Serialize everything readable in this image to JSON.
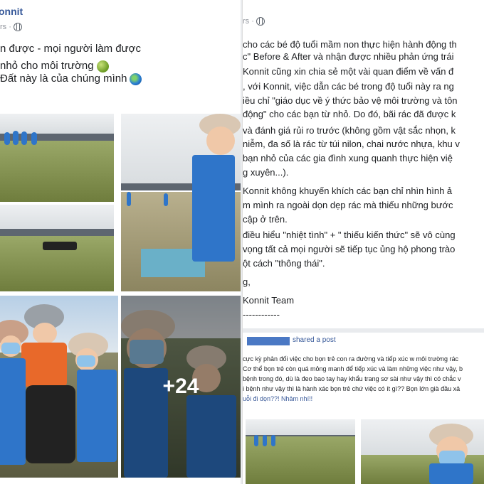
{
  "left_post": {
    "page_name": "onnit",
    "time": "rs ·",
    "lines": [
      "n được - mọi người làm được",
      "nhỏ cho môi trường",
      "Đất này là của chúng mình"
    ],
    "more_photos": "+24"
  },
  "right_post": {
    "time": "rs ·",
    "paragraphs": [
      "cho các bé độ tuổi mầm non thực hiện hành động th",
      "c\" Before & After và nhận được nhiều phản ứng trái",
      "Konnit cũng xin chia sẻ một vài quan điểm về vấn đ",
      ", với Konnit, việc dẫn các bé trong độ tuổi này ra ng",
      "iều chỉ \"giáo dục về ý thức bảo vệ môi trường và tôn",
      "động\" cho các bạn từ nhỏ. Do đó, bãi rác đã được k",
      "và đánh giá rủi ro trước (không gồm vật sắc nhọn, k",
      "niễm, đa số là rác từ túi nilon, chai nước nhựa, khu v",
      "bạn nhỏ của các gia đình xung quanh thực hiện việ",
      "g xuyên...).",
      "Konnit không khuyến khích các bạn chỉ nhìn hình ả",
      "m mình ra ngoài dọn dẹp rác mà thiếu những bước",
      "cập ở trên.",
      "điều hiểu \"nhiệt tình\" + \" thiếu kiến thức\" sẽ vô cùng",
      "vọng tất cả mọi người sẽ tiếp tục ủng hộ phong trào",
      "ột cách \"thông thái\".",
      "g,",
      "Konnit Team",
      "------------"
    ],
    "shared_post": {
      "label": "shared a post",
      "lines": [
        "cực kỳ phản đối việc cho bọn trẻ con ra đường và tiếp xúc w môi trường rác",
        "Cơ thể bọn trẻ còn quá mỏng manh để tiếp xúc và làm những việc như vậy, b",
        "bệnh trong đó, dù là đeo bao tay hay khẩu trang sơ sài như vậy thì có chắc v",
        "i bệnh như vậy thì là hành xác bọn trẻ chứ việc có ít gì?? Bọn lớn già đầu xả",
        "uỗi đi dọn??! Nhảm nhí!!"
      ]
    }
  },
  "colors": {
    "link_blue": "#365899",
    "shirt_blue": "#2f75c9",
    "background": "#e9ebee"
  }
}
